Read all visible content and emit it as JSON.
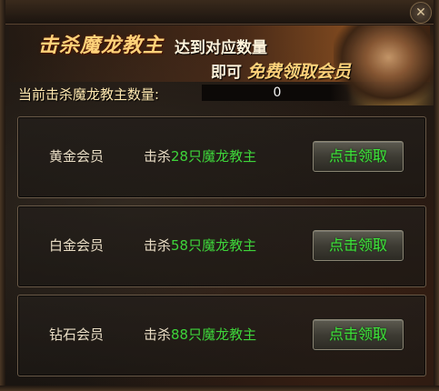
{
  "header": {
    "title_main": "击杀魔龙教主",
    "title_line1": "达到对应数量",
    "title_line2_prefix": "即可",
    "title_line2_emphasis": "免费领取会员"
  },
  "kill_counter": {
    "label": "当前击杀魔龙教主数量:",
    "value": "0"
  },
  "rewards": [
    {
      "tier": "黄金会员",
      "req_prefix": "击杀",
      "req_count": "28只魔龙教主",
      "button": "点击领取"
    },
    {
      "tier": "白金会员",
      "req_prefix": "击杀",
      "req_count": "58只魔龙教主",
      "button": "点击领取"
    },
    {
      "tier": "钻石会员",
      "req_prefix": "击杀",
      "req_count": "88只魔龙教主",
      "button": "点击领取"
    }
  ],
  "colors": {
    "highlight_green": "#3ed43a",
    "title_gold": "#ffd27a"
  },
  "icons": {
    "close": "close-icon"
  }
}
